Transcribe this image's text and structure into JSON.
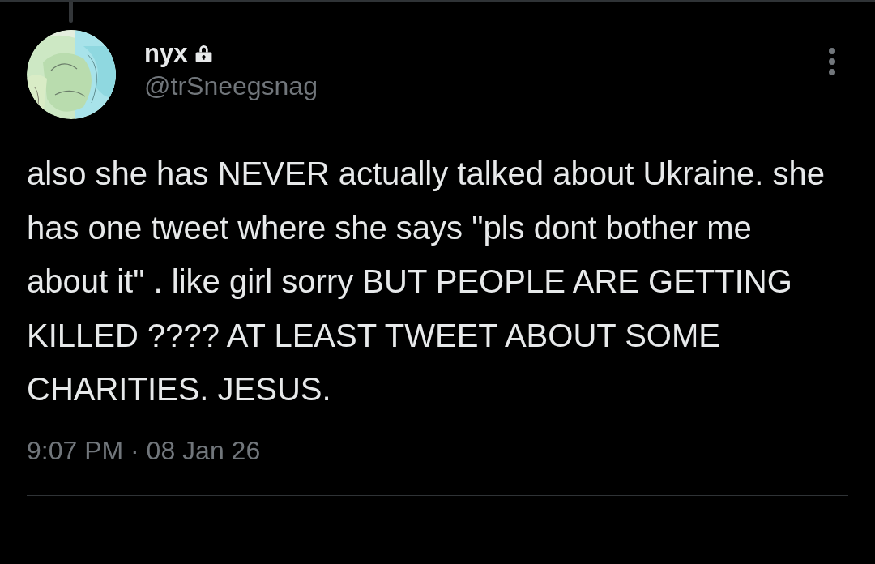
{
  "tweet": {
    "author": {
      "name": "nyx",
      "protected": true,
      "handle": "@trSneegsnag"
    },
    "text": "also she has NEVER actually talked about Ukraine. she has one tweet where she says \"pls dont bother me about it\" . like girl sorry BUT PEOPLE ARE GETTING KILLED ???? AT LEAST TWEET ABOUT SOME CHARITIES. JESUS.",
    "timestamp": "9:07 PM · 08 Jan 26"
  }
}
